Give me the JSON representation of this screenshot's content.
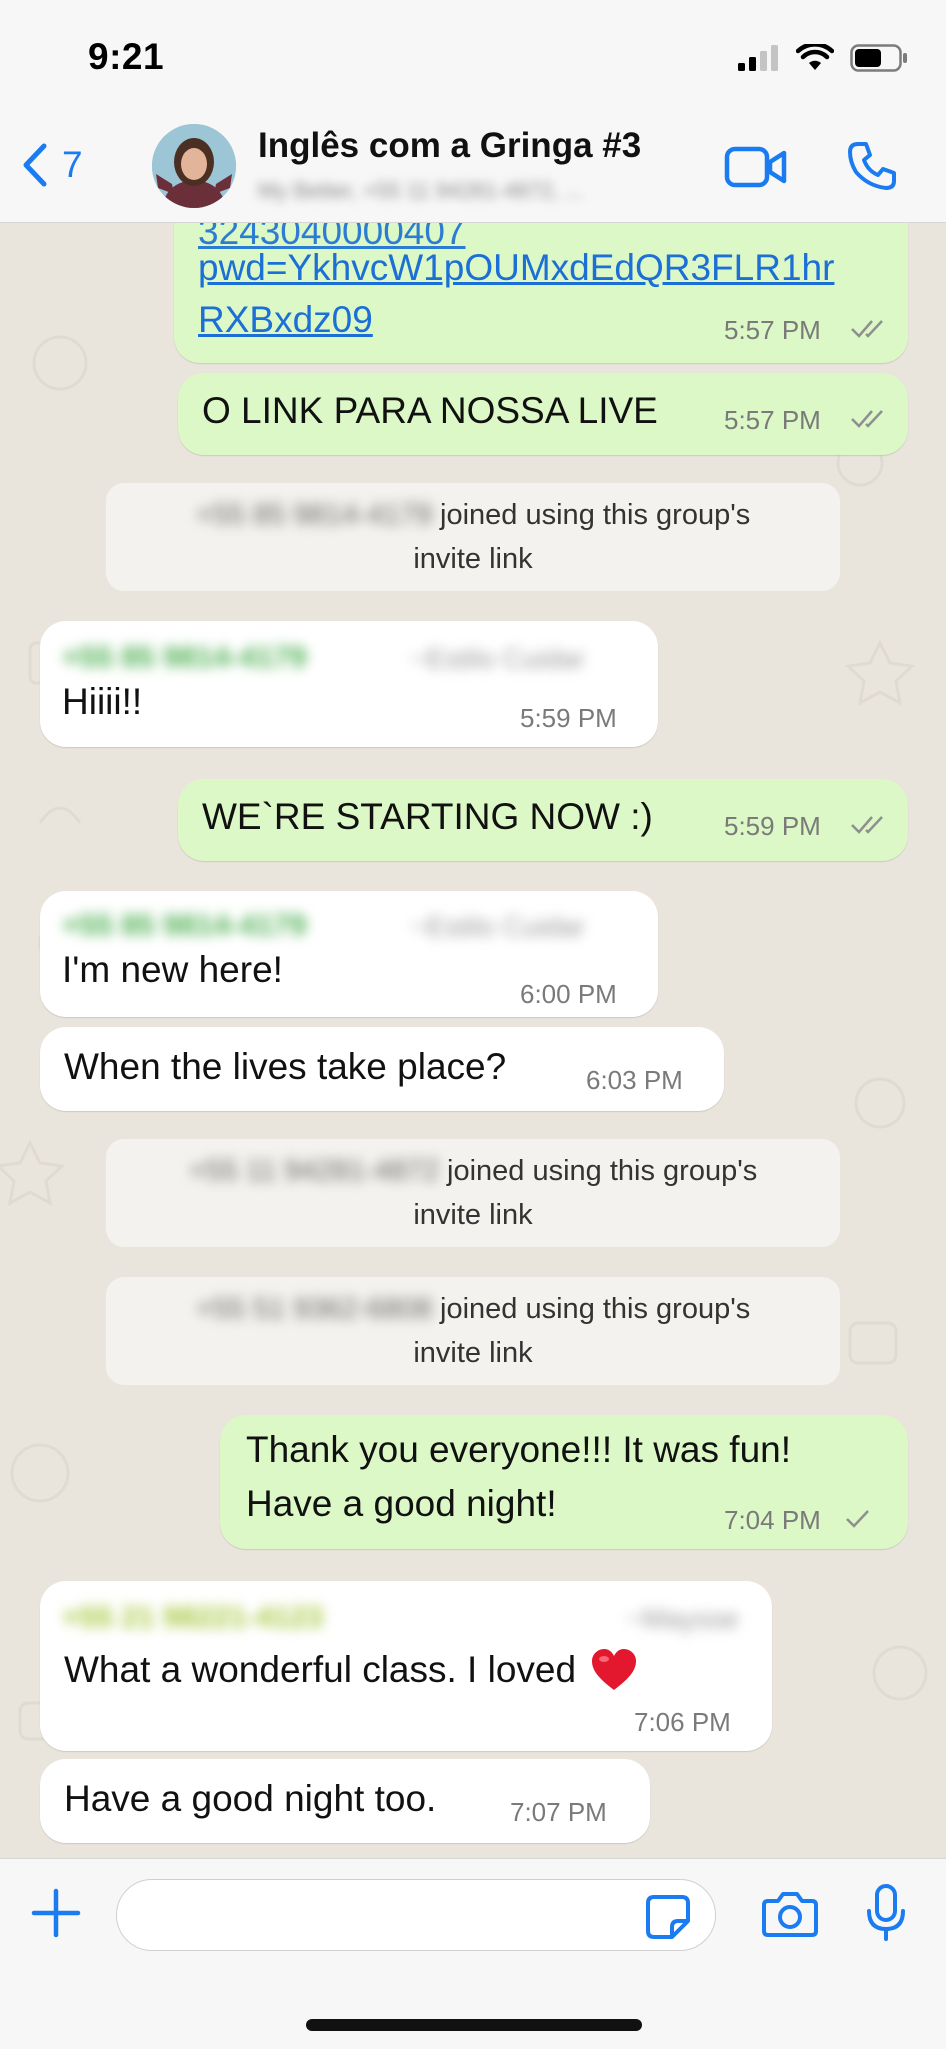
{
  "status_bar": {
    "time": "9:21"
  },
  "header": {
    "back_count": "7",
    "title": "Inglês com a Gringa #3",
    "subtitle": "My Better, +55 11 94281-4872, ..."
  },
  "messages": [
    {
      "type": "out",
      "lines": [
        "pwd=YkhvcW1pOUMxdEdQR3FLR1hr",
        "RXBxdz09"
      ],
      "partial_line": "3243040000407",
      "time": "5:57 PM",
      "status": "read"
    },
    {
      "type": "out",
      "text": "O LINK PARA NOSSA LIVE",
      "time": "5:57 PM",
      "status": "read"
    },
    {
      "type": "system",
      "phone": "+55 85 9814-4179",
      "text_line1": "joined using this group's",
      "text_line2": "invite link"
    },
    {
      "type": "in",
      "sender": "+55 85 9814-4179",
      "sender_name": "~Estilo Cuidar",
      "text": "Hiiii!!",
      "time": "5:59 PM"
    },
    {
      "type": "out",
      "text": "WE`RE STARTING NOW :)",
      "time": "5:59 PM",
      "status": "read"
    },
    {
      "type": "in",
      "sender": "+55 85 9814-4179",
      "sender_name": "~Estilo Cuidar",
      "text": "I'm new here!",
      "time": "6:00 PM"
    },
    {
      "type": "in",
      "text": "When the lives take place?",
      "time": "6:03 PM"
    },
    {
      "type": "system",
      "phone": "+55 11 94281-4872",
      "text_line1": "joined using this group's",
      "text_line2": "invite link"
    },
    {
      "type": "system",
      "phone": "+55 51 9362-6808",
      "text_line1": "joined using this group's",
      "text_line2": "invite link"
    },
    {
      "type": "out",
      "lines": [
        "Thank you everyone!!! It was fun!",
        "Have a good night!"
      ],
      "time": "7:04 PM",
      "status": "sent"
    },
    {
      "type": "in",
      "sender": "+55 21 98221-4123",
      "sender_name": "~Maysse",
      "text": "What a wonderful class. I loved",
      "emoji": "❤️",
      "time": "7:06 PM"
    },
    {
      "type": "in",
      "text": "Have a good night too.",
      "time": "7:07 PM"
    }
  ],
  "composer": {
    "placeholder": ""
  },
  "colors": {
    "accent": "#1a7cf0",
    "outgoing_bubble": "#dcf8c6",
    "incoming_bubble": "#ffffff",
    "chat_background": "#e9e4dc",
    "sender_green": "#4caf50",
    "sender_lime": "#a4c639",
    "read_ticks": "#8f8f8f"
  },
  "icons": [
    "back-chevron-icon",
    "video-call-icon",
    "phone-icon",
    "plus-icon",
    "sticker-icon",
    "camera-icon",
    "microphone-icon",
    "double-check-icon",
    "single-check-icon",
    "heart-emoji"
  ]
}
